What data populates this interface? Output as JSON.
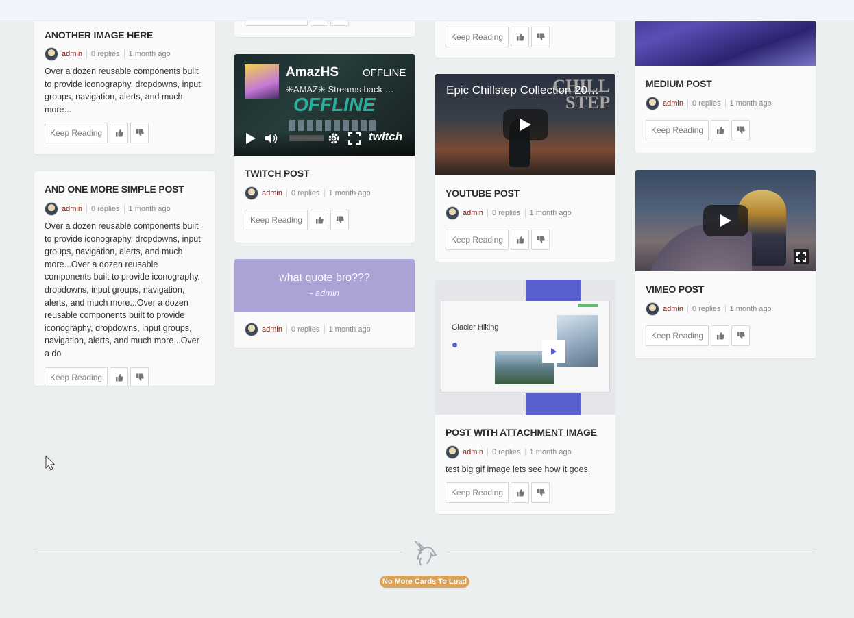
{
  "common": {
    "keep_reading": "Keep Reading",
    "author": "admin",
    "replies": "0 replies",
    "time": "1 month ago"
  },
  "col1": [
    {
      "title": "ANOTHER IMAGE HERE",
      "excerpt": "Over a dozen reusable components built to provide iconography, dropdowns, input groups, navigation, alerts, and much more..."
    },
    {
      "title": "AND ONE MORE SIMPLE POST",
      "excerpt": "Over a dozen reusable components built to provide iconography, dropdowns, input groups, navigation, alerts, and much more...Over a dozen reusable components built to provide iconography, dropdowns, input groups, navigation, alerts, and much more...Over a dozen reusable components built to provide iconography, dropdowns, input groups, navigation, alerts, and much more...Over a do"
    }
  ],
  "col2": {
    "twitch": {
      "channel": "AmazHS",
      "status": "OFFLINE",
      "stream_title": "✳AMAZ✳ Streams back …",
      "offline_banner": "OFFLINE",
      "logo": "twitch",
      "title": "TWITCH POST"
    },
    "quote": {
      "text": "what quote bro???",
      "by": "- admin"
    }
  },
  "col3": {
    "youtube": {
      "video_title": "Epic Chillstep Collection 20…",
      "thumb_text": "CHILL STEP",
      "title": "YOUTUBE POST"
    },
    "attachment": {
      "title": "POST WITH ATTACHMENT IMAGE",
      "excerpt": "test big gif image lets see how it goes.",
      "preview_heading": "Glacier Hiking"
    }
  },
  "col4": {
    "medium": {
      "title": "MEDIUM POST"
    },
    "vimeo": {
      "title": "VIMEO POST"
    }
  },
  "footer": {
    "no_more": "No More Cards To Load",
    "logo": "unicorn-icon"
  },
  "colors": {
    "author": "#7b1a12",
    "quote_bg": "#aba3d6",
    "badge": "#d9a35a"
  }
}
